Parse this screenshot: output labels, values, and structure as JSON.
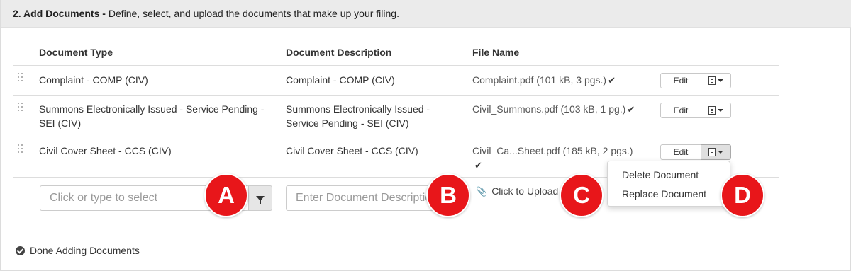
{
  "header": {
    "step_label": "2. Add Documents -",
    "description": " Define, select, and upload the documents that make up your filing."
  },
  "columns": {
    "document_type": "Document Type",
    "document_description": "Document Description",
    "file_name": "File Name"
  },
  "rows": [
    {
      "type_line1": "Complaint - COMP (CIV)",
      "type_line2": "",
      "description_line1": "Complaint - COMP (CIV)",
      "description_line2": "",
      "file": "Complaint.pdf (101 kB, 3 pgs.)",
      "edit_label": "Edit"
    },
    {
      "type_line1": "Summons Electronically Issued - Service Pending -",
      "type_line2": "SEI (CIV)",
      "description_line1": "Summons Electronically Issued -",
      "description_line2": "Service Pending - SEI (CIV)",
      "file": "Civil_Summons.pdf (103 kB, 1 pg.)",
      "edit_label": "Edit"
    },
    {
      "type_line1": "Civil Cover Sheet - CCS (CIV)",
      "type_line2": "",
      "description_line1": "Civil Cover Sheet - CCS (CIV)",
      "description_line2": "",
      "file": "Civil_Ca...Sheet.pdf (185 kB, 2 pgs.)",
      "edit_label": "Edit"
    }
  ],
  "new_row": {
    "type_placeholder": "Click or type to select",
    "description_placeholder": "Enter Document Description",
    "upload_label": "Click to Upload"
  },
  "dropdown_menu": {
    "items": [
      "Delete Document",
      "Replace Document"
    ]
  },
  "callouts": [
    "A",
    "B",
    "C",
    "D"
  ],
  "footer": {
    "done_label": "Done Adding Documents"
  },
  "icons": {
    "drag": "drag-handle-icon",
    "check": "checkmark-icon",
    "document": "document-icon",
    "filter": "filter-icon",
    "paperclip": "paperclip-icon",
    "done": "check-circle-icon"
  },
  "colors": {
    "callout": "#e8161a",
    "header_bg": "#ebebeb"
  }
}
